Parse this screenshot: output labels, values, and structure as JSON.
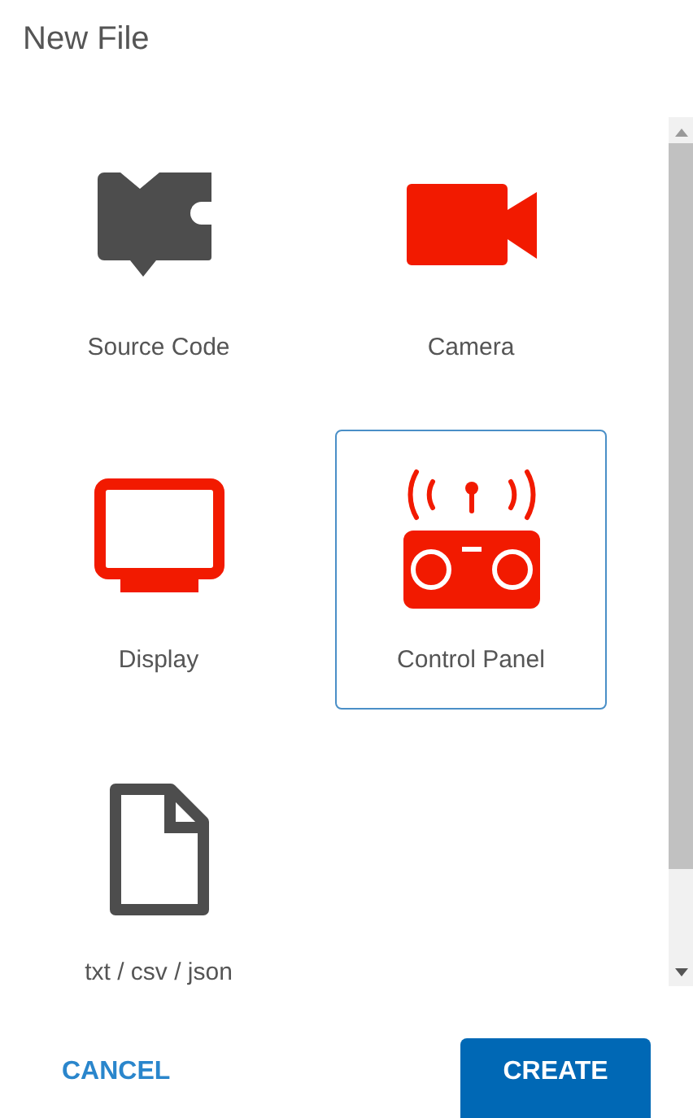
{
  "title": "New File",
  "items": [
    {
      "label": "Source Code",
      "kind": "code",
      "color": "#4d4d4d",
      "selected": false
    },
    {
      "label": "Camera",
      "kind": "camera",
      "color": "#f21a00",
      "selected": false
    },
    {
      "label": "Display",
      "kind": "display",
      "color": "#f21a00",
      "selected": false
    },
    {
      "label": "Control Panel",
      "kind": "remote",
      "color": "#f21a00",
      "selected": true
    },
    {
      "label": "txt / csv / json",
      "kind": "file",
      "color": "#4d4d4d",
      "selected": false
    }
  ],
  "buttons": [
    {
      "label": "CANCEL",
      "kind": "text"
    },
    {
      "label": "CREATE",
      "kind": "filled"
    }
  ]
}
